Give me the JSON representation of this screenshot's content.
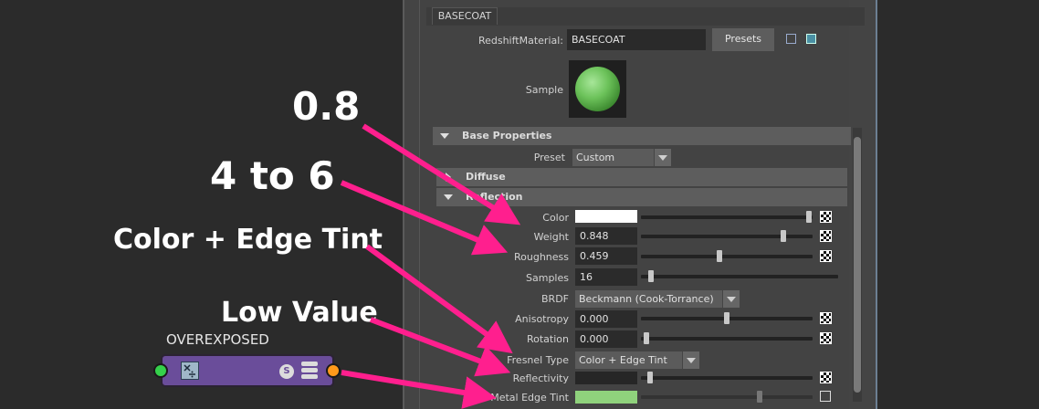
{
  "tab": {
    "label": "BASECOAT"
  },
  "material": {
    "label": "RedshiftMaterial:",
    "value": "BASECOAT",
    "presets_label": "Presets"
  },
  "sample": {
    "label": "Sample"
  },
  "base_properties": {
    "title": "Base Properties",
    "preset_label": "Preset",
    "preset_value": "Custom"
  },
  "diffuse": {
    "title": "Diffuse"
  },
  "reflection": {
    "title": "Reflection",
    "color_label": "Color",
    "color_value": "#ffffff",
    "weight_label": "Weight",
    "weight_value": "0.848",
    "roughness_label": "Roughness",
    "roughness_value": "0.459",
    "samples_label": "Samples",
    "samples_value": "16",
    "brdf_label": "BRDF",
    "brdf_value": "Beckmann (Cook-Torrance)",
    "anisotropy_label": "Anisotropy",
    "anisotropy_value": "0.000",
    "rotation_label": "Rotation",
    "rotation_value": "0.000",
    "fresnel_label": "Fresnel Type",
    "fresnel_value": "Color + Edge Tint",
    "reflectivity_label": "Reflectivity",
    "metal_edge_tint_label": "Metal Edge Tint",
    "metal_edge_tint_color": "#8fd27c"
  },
  "annotations": {
    "a1": "0.8",
    "a2": "4 to 6",
    "a3": "Color + Edge Tint",
    "a4": "Low Value",
    "arrow_color": "#ff1f8e"
  },
  "node": {
    "title": "OVEREXPOSED",
    "body_color": "#6a4d9a",
    "input_port_color": "#35d14b",
    "output_port_color": "#ff9a1a",
    "s_icon_label": "S"
  }
}
